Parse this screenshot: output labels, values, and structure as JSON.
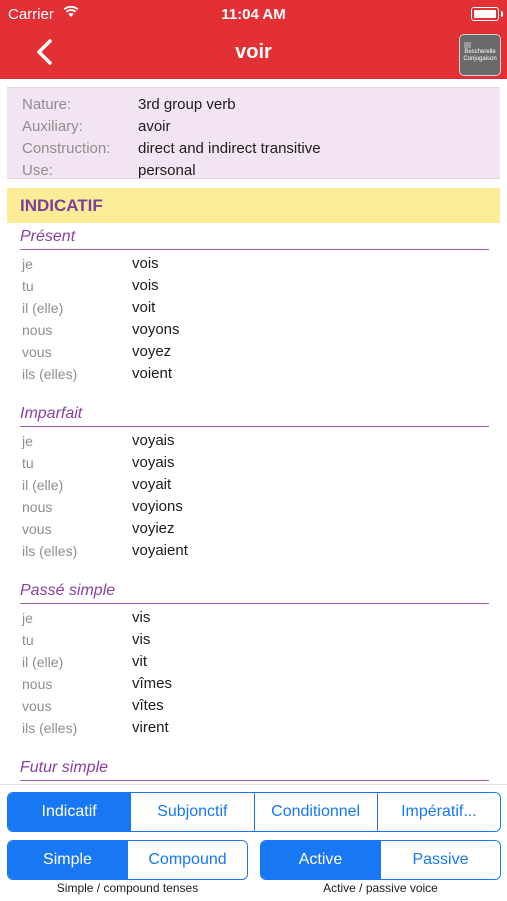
{
  "status_bar": {
    "carrier": "Carrier",
    "time": "11:04 AM",
    "wifi_icon": "wifi-icon",
    "battery_icon": "battery-icon"
  },
  "header": {
    "title": "voir",
    "back_icon": "chevron-left-icon",
    "logo_text": "Bescherelle Conjugaison",
    "background": "#e23035"
  },
  "info": {
    "rows": [
      {
        "key": "Nature:",
        "value": "3rd group verb"
      },
      {
        "key": "Auxiliary:",
        "value": "avoir"
      },
      {
        "key": "Construction:",
        "value": "direct and indirect transitive"
      },
      {
        "key": "Use:",
        "value": "personal"
      }
    ]
  },
  "mood": {
    "title": "INDICATIF"
  },
  "pronouns": [
    "je",
    "tu",
    "il (elle)",
    "nous",
    "vous",
    "ils (elles)"
  ],
  "tenses": [
    {
      "name": "Présent",
      "forms": [
        "vois",
        "vois",
        "voit",
        "voyons",
        "voyez",
        "voient"
      ]
    },
    {
      "name": "Imparfait",
      "forms": [
        "voyais",
        "voyais",
        "voyait",
        "voyions",
        "voyiez",
        "voyaient"
      ]
    },
    {
      "name": "Passé simple",
      "forms": [
        "vis",
        "vis",
        "vit",
        "vîmes",
        "vîtes",
        "virent"
      ]
    },
    {
      "name": "Futur simple",
      "forms": []
    }
  ],
  "mood_selector": {
    "options": [
      "Indicatif",
      "Subjonctif",
      "Conditionnel",
      "Impératif..."
    ],
    "selected": "Indicatif"
  },
  "tense_type_selector": {
    "options": [
      "Simple",
      "Compound"
    ],
    "selected": "Simple",
    "caption": "Simple / compound tenses"
  },
  "voice_selector": {
    "options": [
      "Active",
      "Passive"
    ],
    "selected": "Active",
    "caption": "Active / passive voice"
  },
  "colors": {
    "accent": "#1877f2",
    "header": "#e23035",
    "section": "#fcec98",
    "tense": "#8a3fa0",
    "info_bg": "#f2e4f2"
  }
}
